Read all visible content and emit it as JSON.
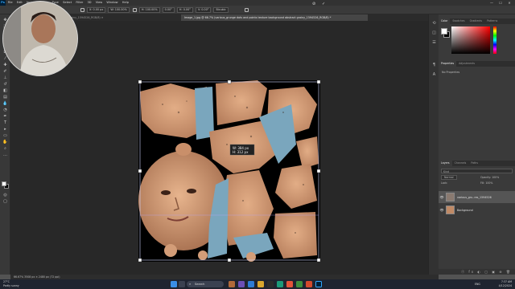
{
  "app": {
    "logo": "Ps",
    "menu": [
      "File",
      "Edit",
      "Image",
      "Layer",
      "Type",
      "Select",
      "Filter",
      "3D",
      "View",
      "Window",
      "Help"
    ],
    "window_controls": [
      "—",
      "☐",
      "✕"
    ]
  },
  "options": {
    "x_field": "X: 0.00 px",
    "w_field": "W: 100.00%",
    "h_field": "H: 100.00%",
    "angle_field": "0.00°",
    "h_skew": "H: 0.00°",
    "v_skew": "V: 0.00°",
    "interp": "Bicubic",
    "cancel_icon": "cancel-icon",
    "commit_icon": "commit-icon"
  },
  "document": {
    "tab_inactive": "...nd points texture background abstract grainy_1594526_RGB/8) ✕",
    "tab_active": "Image_1.jpg @ 66.7% (various_grunge dots and points texture background abstract grainy_1594526_RGB/8) *",
    "transform_readout_w": "W: 384 px",
    "transform_readout_h": "H: 312 px"
  },
  "panels": {
    "color_tabs": [
      "Color",
      "Swatches",
      "Gradients",
      "Patterns"
    ],
    "props_tabs": [
      "Properties",
      "Adjustments"
    ],
    "props_text": "No Properties",
    "layers_tabs": [
      "Layers",
      "Channels",
      "Paths"
    ],
    "search_placeholder": "Kind",
    "blend_mode": "Normal",
    "opacity_label": "Opacity: 100%",
    "lock_label": "Lock:",
    "fill_label": "Fill: 100%",
    "layers": [
      {
        "name": "various_gru..res_1594526",
        "selected": true
      },
      {
        "name": "Background",
        "selected": false
      }
    ],
    "footer_icons": "ⓕ fx ◐ ▢ ▣ ⊕ 🗑"
  },
  "status": {
    "text": "66.67%   3508 px × 2480 px (72 ppi)"
  },
  "taskbar": {
    "weather_temp": "27°C",
    "weather_desc": "Partly sunny",
    "search_label": "Search",
    "lang": "ENG",
    "time": "7:37 AM",
    "date": "4/12/2024"
  },
  "colors": {
    "accent": "#31a8ff",
    "panel_bg": "#3a3a3a",
    "canvas_bg": "#282828"
  }
}
